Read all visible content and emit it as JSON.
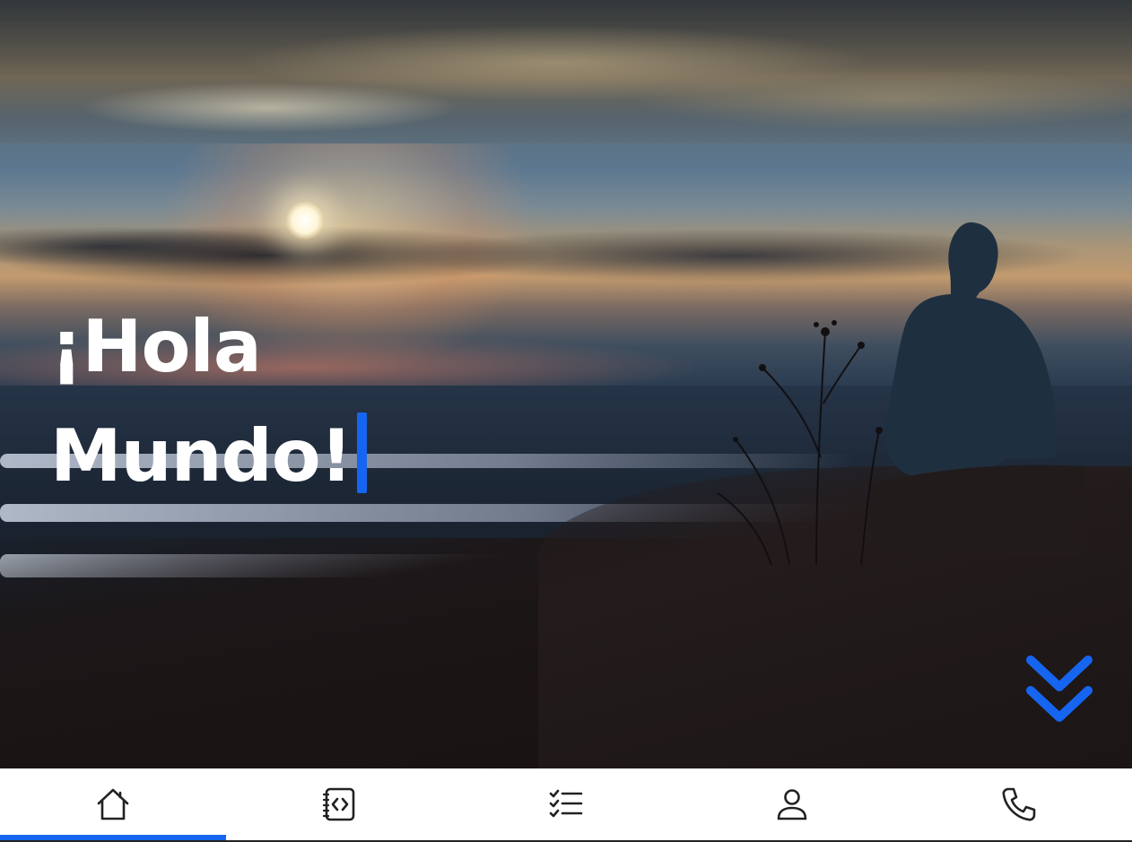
{
  "hero": {
    "title_line1": "¡Hola",
    "title_line2": "Mundo!"
  },
  "scroll_button": {
    "icon": "double-chevron-down-icon"
  },
  "nav": {
    "active_index": 0,
    "items": [
      {
        "icon": "home-icon"
      },
      {
        "icon": "code-file-icon"
      },
      {
        "icon": "checklist-icon"
      },
      {
        "icon": "user-icon"
      },
      {
        "icon": "phone-icon"
      }
    ]
  },
  "colors": {
    "accent": "#1665f0",
    "title": "#ffffff",
    "navbar_bg": "#ffffff",
    "icon": "#222222"
  }
}
